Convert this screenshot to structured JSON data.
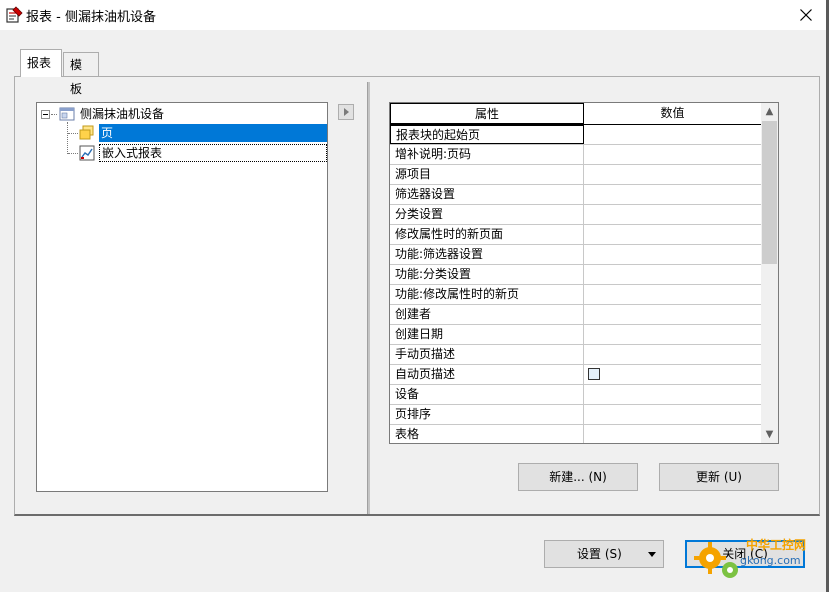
{
  "window": {
    "title": "报表 - 侧漏抹油机设备",
    "close_label": "✕"
  },
  "tabs": [
    {
      "label": "报表",
      "active": true
    },
    {
      "label": "模板",
      "active": false
    }
  ],
  "tree": {
    "root": {
      "label": "侧漏抹油机设备",
      "icon": "report-window-icon"
    },
    "children": [
      {
        "label": "页",
        "icon": "page-icon",
        "selected": true
      },
      {
        "label": "嵌入式报表",
        "icon": "embedded-report-icon",
        "selected": false
      }
    ]
  },
  "grid": {
    "headers": [
      "属性",
      "数值"
    ],
    "rows": [
      {
        "name": "报表块的起始页",
        "value": ""
      },
      {
        "name": "增补说明:页码",
        "value": ""
      },
      {
        "name": "源项目",
        "value": ""
      },
      {
        "name": "筛选器设置",
        "value": ""
      },
      {
        "name": "分类设置",
        "value": ""
      },
      {
        "name": "修改属性时的新页面",
        "value": ""
      },
      {
        "name": "功能:筛选器设置",
        "value": ""
      },
      {
        "name": "功能:分类设置",
        "value": ""
      },
      {
        "name": "功能:修改属性时的新页",
        "value": ""
      },
      {
        "name": "创建者",
        "value": ""
      },
      {
        "name": "创建日期",
        "value": ""
      },
      {
        "name": "手动页描述",
        "value": ""
      },
      {
        "name": "自动页描述",
        "value": "",
        "checkbox": true
      },
      {
        "name": "设备",
        "value": ""
      },
      {
        "name": "页排序",
        "value": ""
      },
      {
        "name": "表格",
        "value": ""
      }
    ]
  },
  "buttons": {
    "new_label": "新建... (N)",
    "update_label": "更新 (U)",
    "settings_label": "设置 (S)",
    "close_label": "关闭 (C)"
  },
  "watermark": {
    "line1": "中华工控网",
    "line2": "gkong.com"
  },
  "colors": {
    "selection": "#0078d7",
    "background": "#f0f0f0",
    "watermark_orange": "#f5a300",
    "watermark_blue": "#2a6fb5"
  }
}
